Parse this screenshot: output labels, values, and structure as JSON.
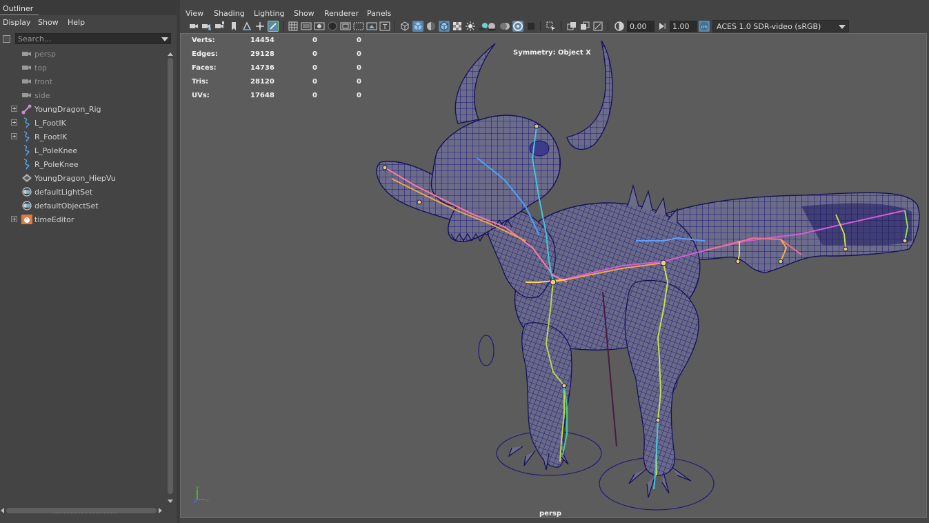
{
  "outliner": {
    "title": "Outliner",
    "menu": [
      "Display",
      "Show",
      "Help"
    ],
    "search_placeholder": "Search...",
    "items": [
      {
        "label": "persp",
        "icon": "camera-icon",
        "dim": true,
        "expandable": false
      },
      {
        "label": "top",
        "icon": "camera-icon",
        "dim": true,
        "expandable": false
      },
      {
        "label": "front",
        "icon": "camera-icon",
        "dim": true,
        "expandable": false
      },
      {
        "label": "side",
        "icon": "camera-icon",
        "dim": true,
        "expandable": false
      },
      {
        "label": "YoungDragon_Rig",
        "icon": "joint-icon",
        "dim": false,
        "expandable": true
      },
      {
        "label": "L_FootIK",
        "icon": "curve-icon",
        "dim": false,
        "expandable": true
      },
      {
        "label": "R_FootIK",
        "icon": "curve-icon",
        "dim": false,
        "expandable": true
      },
      {
        "label": "L_PoleKnee",
        "icon": "curve-icon",
        "dim": false,
        "expandable": false
      },
      {
        "label": "R_PoleKnee",
        "icon": "curve-icon",
        "dim": false,
        "expandable": false
      },
      {
        "label": "YoungDragon_HiepVu",
        "icon": "mesh-icon",
        "dim": false,
        "expandable": false
      },
      {
        "label": "defaultLightSet",
        "icon": "set-icon",
        "dim": false,
        "expandable": false
      },
      {
        "label": "defaultObjectSet",
        "icon": "set-icon",
        "dim": false,
        "expandable": false
      },
      {
        "label": "timeEditor",
        "icon": "time-editor-icon",
        "dim": false,
        "expandable": true
      }
    ]
  },
  "panel": {
    "menu": [
      "View",
      "Shading",
      "Lighting",
      "Show",
      "Renderer",
      "Panels"
    ],
    "exposure_value": "0.00",
    "gamma_value": "1.00",
    "color_space": "ACES 1.0 SDR-video (sRGB)"
  },
  "hud": {
    "stats": [
      {
        "label": "Verts:",
        "values": [
          "14454",
          "0",
          "0"
        ]
      },
      {
        "label": "Edges:",
        "values": [
          "29128",
          "0",
          "0"
        ]
      },
      {
        "label": "Faces:",
        "values": [
          "14736",
          "0",
          "0"
        ]
      },
      {
        "label": "Tris:",
        "values": [
          "28120",
          "0",
          "0"
        ]
      },
      {
        "label": "UVs:",
        "values": [
          "17648",
          "0",
          "0"
        ]
      }
    ],
    "symmetry": "Symmetry: Object X",
    "camera": "persp",
    "axis_labels": {
      "x": "x",
      "y": "y"
    }
  },
  "colors": {
    "wire": "#1c1a7a",
    "mesh": "#6a6a86",
    "accent": "#5a86a8"
  }
}
